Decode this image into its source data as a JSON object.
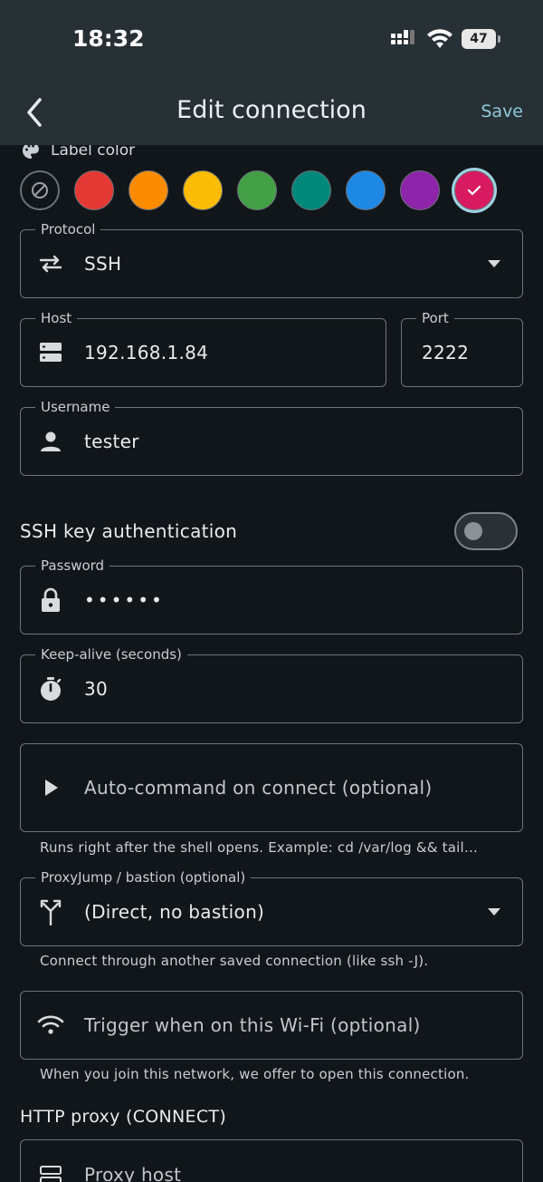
{
  "status": {
    "time": "18:32",
    "battery": "47"
  },
  "header": {
    "title": "Edit connection",
    "save_label": "Save"
  },
  "label_color": {
    "label": "Label color",
    "swatches": [
      {
        "name": "none",
        "color": "transparent"
      },
      {
        "name": "red",
        "color": "#e53935"
      },
      {
        "name": "orange",
        "color": "#fb8c00"
      },
      {
        "name": "yellow",
        "color": "#fbbc05"
      },
      {
        "name": "green",
        "color": "#43a047"
      },
      {
        "name": "teal",
        "color": "#00897b"
      },
      {
        "name": "blue",
        "color": "#1e88e5"
      },
      {
        "name": "purple",
        "color": "#8e24aa"
      },
      {
        "name": "pink",
        "color": "#d81b60",
        "selected": true
      }
    ]
  },
  "protocol": {
    "label": "Protocol",
    "value": "SSH"
  },
  "host": {
    "label": "Host",
    "value": "192.168.1.84"
  },
  "port": {
    "label": "Port",
    "value": "2222"
  },
  "username": {
    "label": "Username",
    "value": "tester"
  },
  "ssh_key": {
    "label": "SSH key authentication",
    "enabled": false
  },
  "password": {
    "label": "Password",
    "value": "••••••"
  },
  "keepalive": {
    "label": "Keep-alive (seconds)",
    "value": "30"
  },
  "auto_command": {
    "placeholder": "Auto-command on connect (optional)",
    "helper": "Runs right after the shell opens. Example: cd /var/log && tail…"
  },
  "proxyjump": {
    "label": "ProxyJump / bastion (optional)",
    "value": "(Direct, no bastion)",
    "helper": "Connect through another saved connection (like ssh -J)."
  },
  "wifi_trigger": {
    "placeholder": "Trigger when on this Wi-Fi (optional)",
    "helper": "When you join this network, we offer to open this connection."
  },
  "http_proxy": {
    "section_label": "HTTP proxy (CONNECT)",
    "host_placeholder": "Proxy host"
  }
}
